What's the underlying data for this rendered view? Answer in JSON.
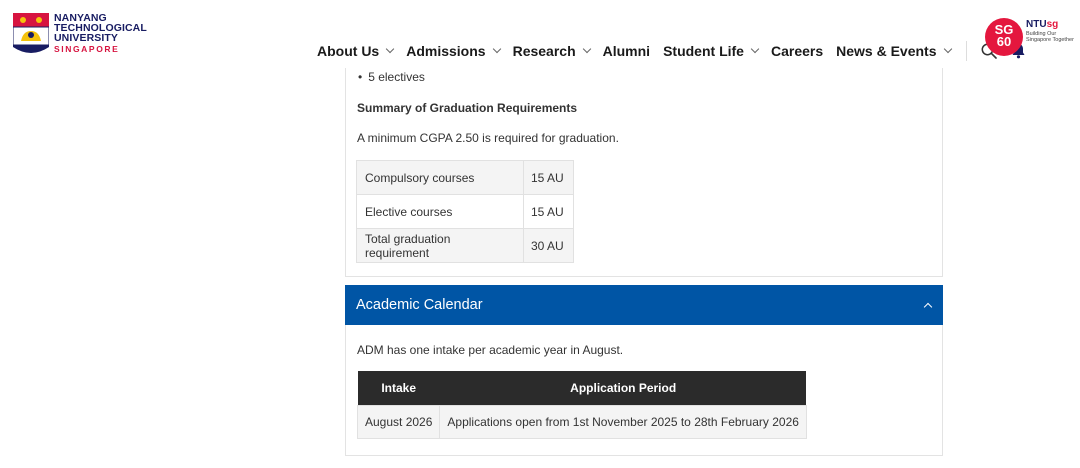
{
  "header": {
    "logo": {
      "line1": "NANYANG",
      "line2": "TECHNOLOGICAL",
      "line3": "UNIVERSITY",
      "line4": "SINGAPORE"
    },
    "nav": [
      {
        "label": "About Us",
        "dropdown": true
      },
      {
        "label": "Admissions",
        "dropdown": true
      },
      {
        "label": "Research",
        "dropdown": true
      },
      {
        "label": "Alumni",
        "dropdown": false
      },
      {
        "label": "Student Life",
        "dropdown": true
      },
      {
        "label": "Careers",
        "dropdown": false
      },
      {
        "label": "News & Events",
        "dropdown": true
      }
    ],
    "icons": [
      "search-icon",
      "bell-icon"
    ],
    "sg60": {
      "line1": "SG",
      "line2": "60"
    },
    "ntusg": {
      "title_prefix": "NTU",
      "title_suffix": "sg",
      "tagline": "Building Our Singapore Together"
    }
  },
  "requirements": {
    "bullet": "5 electives",
    "summary_title": "Summary of Graduation Requirements",
    "cgpa_note": "A minimum CGPA 2.50 is required for graduation.",
    "rows": [
      {
        "label": "Compulsory courses",
        "value": "15 AU"
      },
      {
        "label": "Elective courses",
        "value": "15 AU"
      },
      {
        "label": "Total graduation requirement",
        "value": "30 AU"
      }
    ]
  },
  "calendar": {
    "title": "Academic Calendar",
    "note": "ADM has one intake per academic year in August.",
    "headers": [
      "Intake",
      "Application Period"
    ],
    "rows": [
      {
        "intake": "August 2026",
        "period": "Applications open from 1st November 2025 to 28th February 2026"
      }
    ]
  },
  "colors": {
    "accordion": "#0055a5",
    "table_header": "#2b2b2b",
    "brand_navy": "#181c62",
    "brand_red": "#e4173e"
  }
}
